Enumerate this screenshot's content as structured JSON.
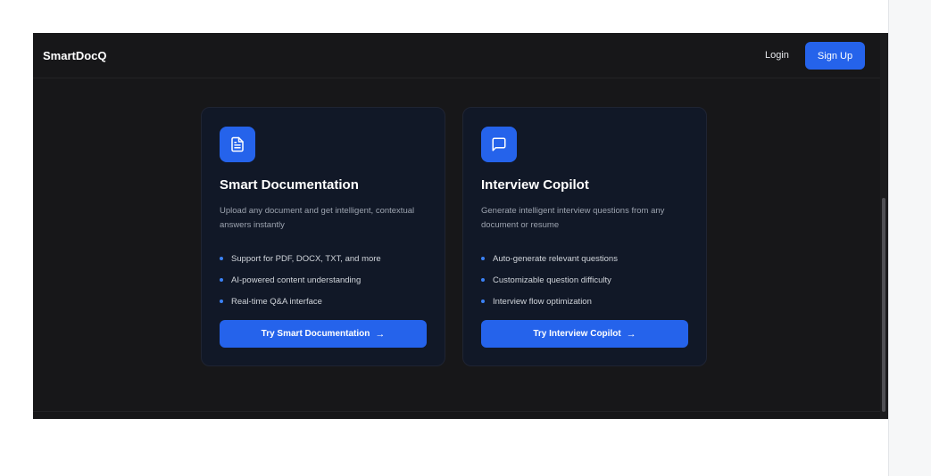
{
  "navbar": {
    "brand": "SmartDocQ",
    "login_label": "Login",
    "signup_label": "Sign Up"
  },
  "cards": [
    {
      "icon": "document-icon",
      "title": "Smart Documentation",
      "description": "Upload any document and get intelligent, contextual answers instantly",
      "features": [
        "Support for PDF, DOCX, TXT, and more",
        "AI-powered content understanding",
        "Real-time Q&A interface"
      ],
      "button_label": "Try Smart Documentation",
      "button_arrow": "→"
    },
    {
      "icon": "chat-bubble-icon",
      "title": "Interview Copilot",
      "description": "Generate intelligent interview questions from any document or resume",
      "features": [
        "Auto-generate relevant questions",
        "Customizable question difficulty",
        "Interview flow optimization"
      ],
      "button_label": "Try Interview Copilot",
      "button_arrow": "→"
    }
  ],
  "colors": {
    "accent": "#2563eb",
    "background": "#171719",
    "card": "#111827"
  }
}
